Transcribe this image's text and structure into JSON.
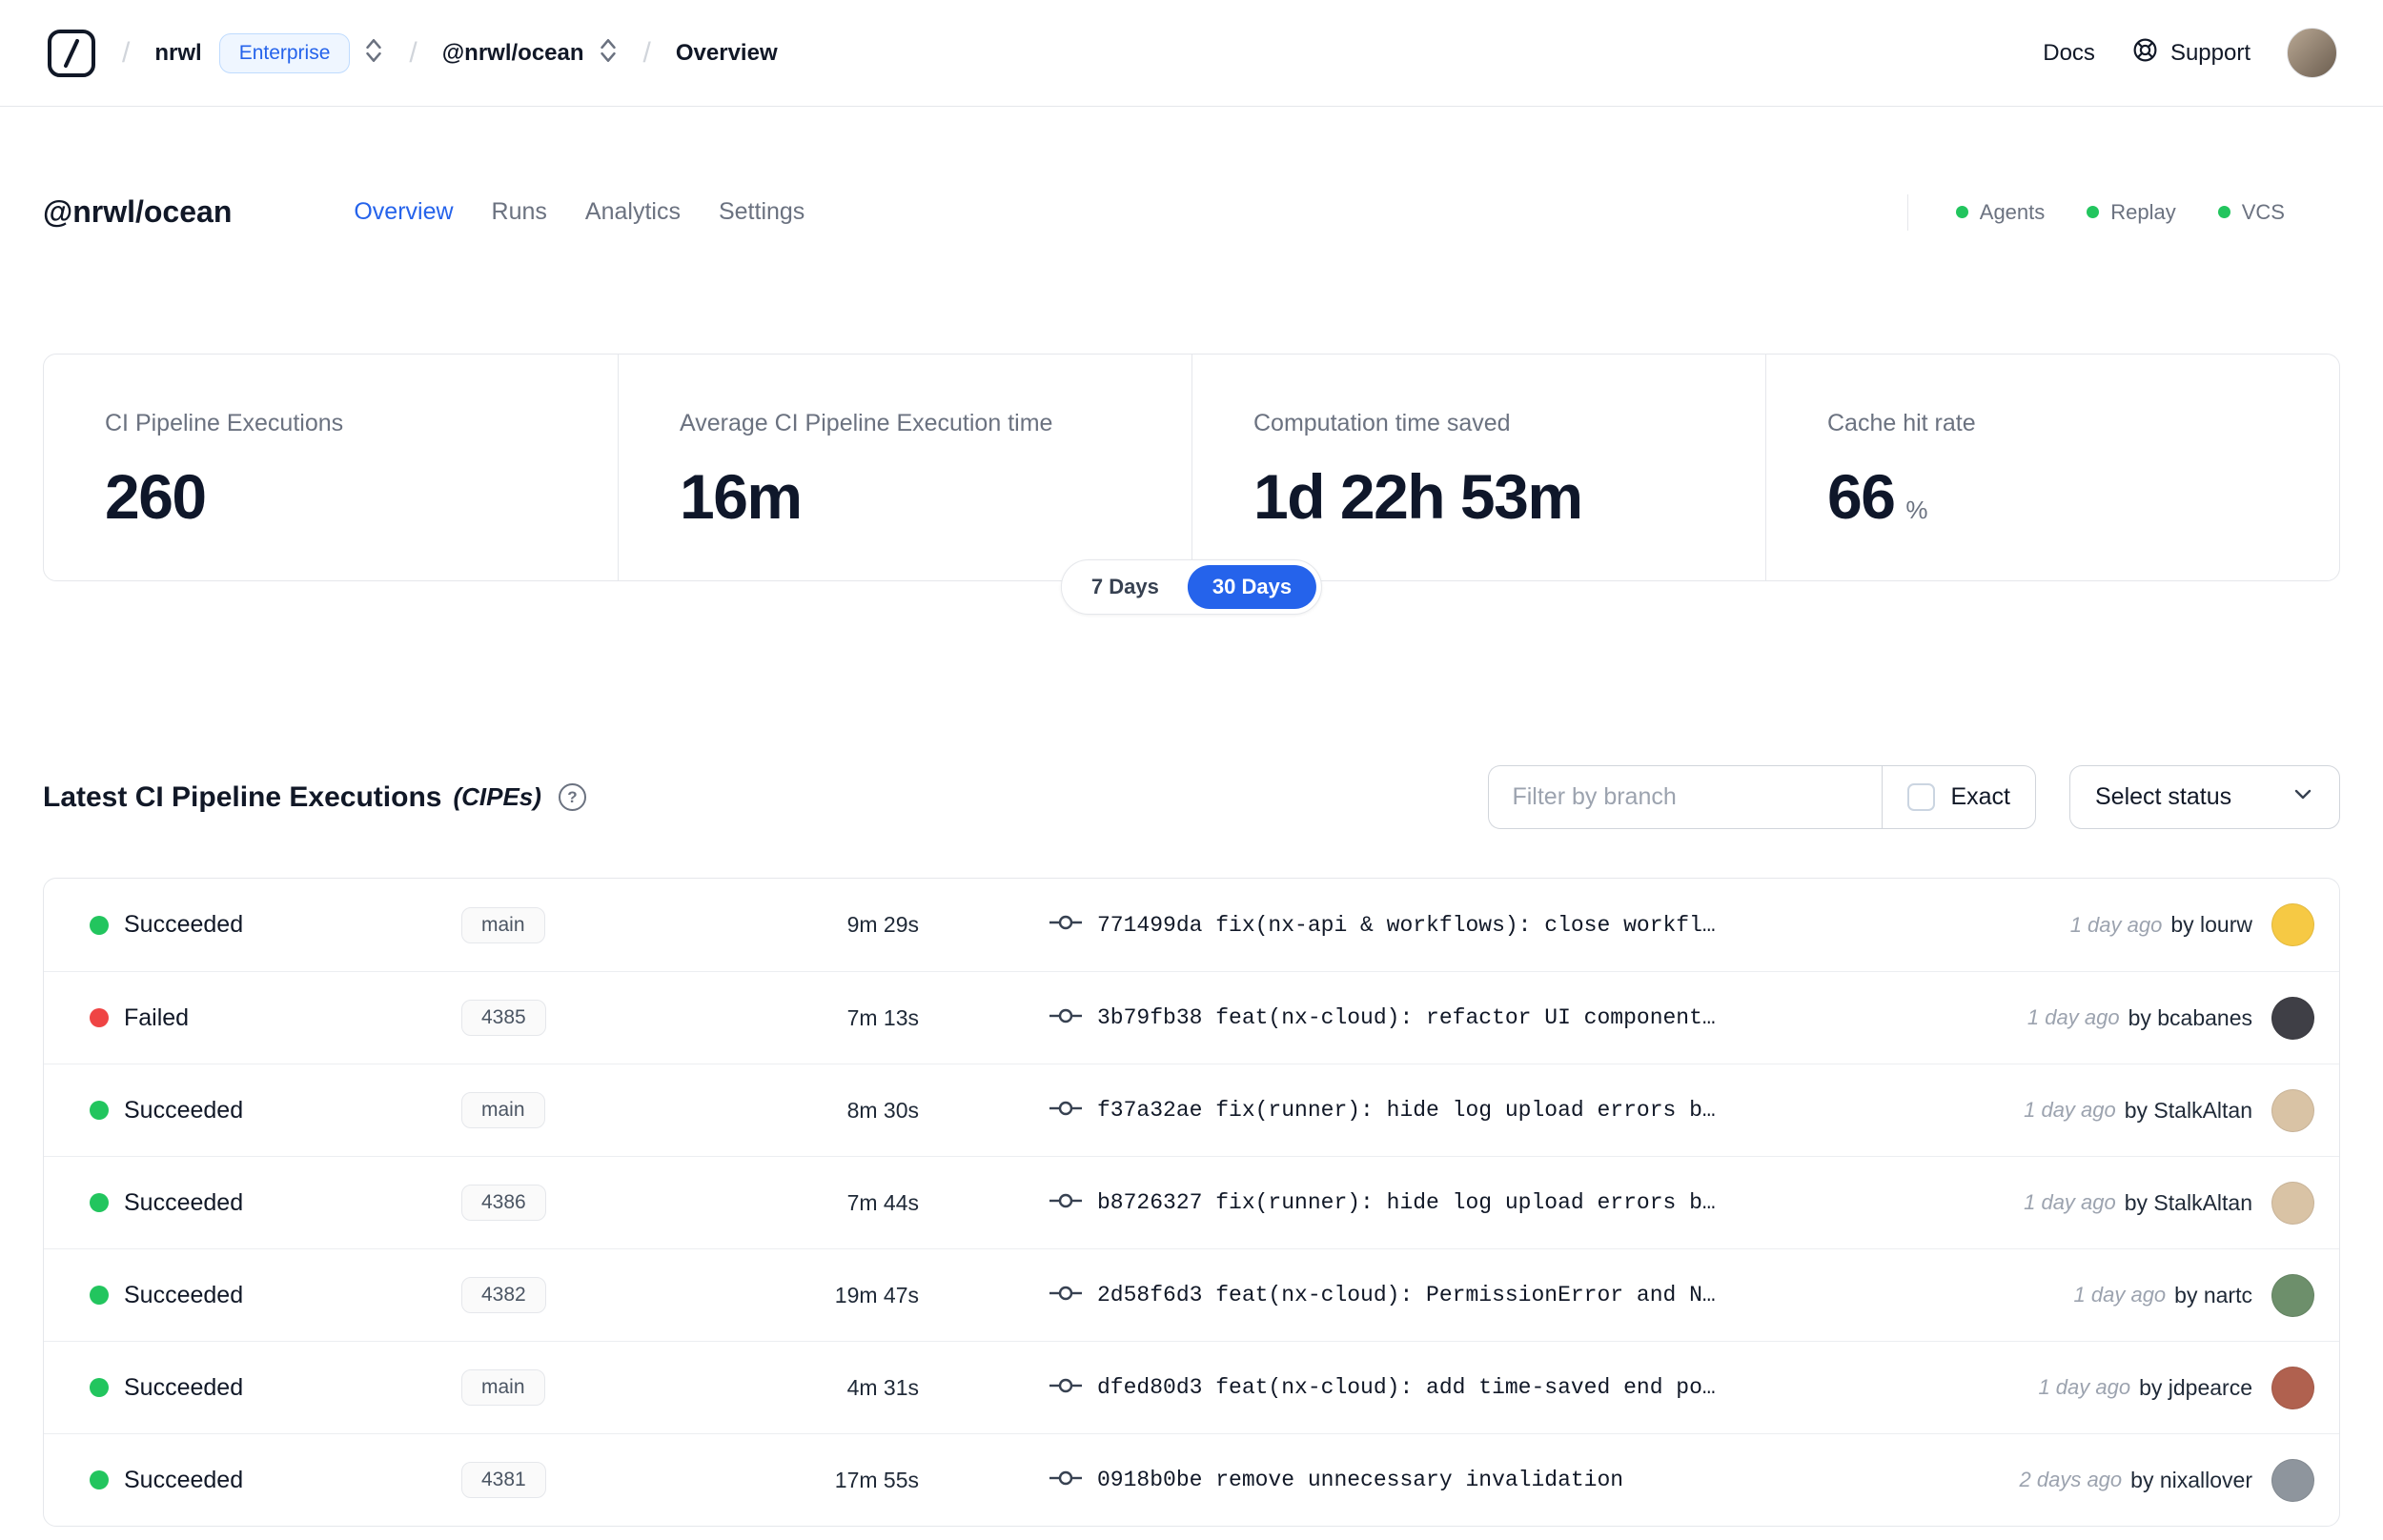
{
  "colors": {
    "accent": "#2563eb",
    "success": "#22c55e",
    "danger": "#ef4444"
  },
  "header": {
    "breadcrumb": {
      "separator": "/",
      "org": "nrwl",
      "org_badge": "Enterprise",
      "workspace": "@nrwl/ocean",
      "page": "Overview"
    },
    "links": {
      "docs": "Docs",
      "support": "Support"
    },
    "icons": {
      "logo": "nx-cloud-logo",
      "support": "lifebuoy-icon",
      "org_selector": "up-down-chevrons-icon",
      "workspace_selector": "up-down-chevrons-icon"
    }
  },
  "workspace": {
    "title": "@nrwl/ocean",
    "tabs": [
      {
        "label": "Overview",
        "active": true
      },
      {
        "label": "Runs",
        "active": false
      },
      {
        "label": "Analytics",
        "active": false
      },
      {
        "label": "Settings",
        "active": false
      }
    ],
    "indicators": [
      {
        "label": "Agents"
      },
      {
        "label": "Replay"
      },
      {
        "label": "VCS"
      }
    ]
  },
  "stats": {
    "cards": [
      {
        "label": "CI Pipeline Executions",
        "value": "260",
        "suffix": ""
      },
      {
        "label": "Average CI Pipeline Execution time",
        "value": "16m",
        "suffix": ""
      },
      {
        "label": "Computation time saved",
        "value": "1d 22h 53m",
        "suffix": ""
      },
      {
        "label": "Cache hit rate",
        "value": "66",
        "suffix": "%"
      }
    ],
    "range_toggle": {
      "options": [
        {
          "label": "7 Days",
          "active": false
        },
        {
          "label": "30 Days",
          "active": true
        }
      ]
    }
  },
  "cipes": {
    "title": "Latest CI Pipeline Executions",
    "title_suffix": "(CIPEs)",
    "help_icon": "question-circle-icon",
    "filter_placeholder": "Filter by branch",
    "exact_label": "Exact",
    "status_select_label": "Select status",
    "rows": [
      {
        "status": "Succeeded",
        "status_color": "#22c55e",
        "branch": "main",
        "duration": "9m 29s",
        "commit": "771499da fix(nx-api & workflows): close workfl…",
        "time": "1 day ago",
        "author": "by lourw",
        "avatar_color": "#f6c944"
      },
      {
        "status": "Failed",
        "status_color": "#ef4444",
        "branch": "4385",
        "duration": "7m 13s",
        "commit": "3b79fb38 feat(nx-cloud): refactor UI component…",
        "time": "1 day ago",
        "author": "by bcabanes",
        "avatar_color": "#3f3f46"
      },
      {
        "status": "Succeeded",
        "status_color": "#22c55e",
        "branch": "main",
        "duration": "8m 30s",
        "commit": "f37a32ae fix(runner): hide log upload errors b…",
        "time": "1 day ago",
        "author": "by StalkAltan",
        "avatar_color": "#d9c3a5"
      },
      {
        "status": "Succeeded",
        "status_color": "#22c55e",
        "branch": "4386",
        "duration": "7m 44s",
        "commit": "b8726327 fix(runner): hide log upload errors b…",
        "time": "1 day ago",
        "author": "by StalkAltan",
        "avatar_color": "#d9c3a5"
      },
      {
        "status": "Succeeded",
        "status_color": "#22c55e",
        "branch": "4382",
        "duration": "19m 47s",
        "commit": "2d58f6d3 feat(nx-cloud): PermissionError and N…",
        "time": "1 day ago",
        "author": "by nartc",
        "avatar_color": "#6d8f6b"
      },
      {
        "status": "Succeeded",
        "status_color": "#22c55e",
        "branch": "main",
        "duration": "4m 31s",
        "commit": "dfed80d3 feat(nx-cloud): add time-saved end po…",
        "time": "1 day ago",
        "author": "by jdpearce",
        "avatar_color": "#b0614f"
      },
      {
        "status": "Succeeded",
        "status_color": "#22c55e",
        "branch": "4381",
        "duration": "17m 55s",
        "commit": "0918b0be remove unnecessary invalidation",
        "time": "2 days ago",
        "author": "by nixallover",
        "avatar_color": "#8e959d"
      }
    ]
  }
}
